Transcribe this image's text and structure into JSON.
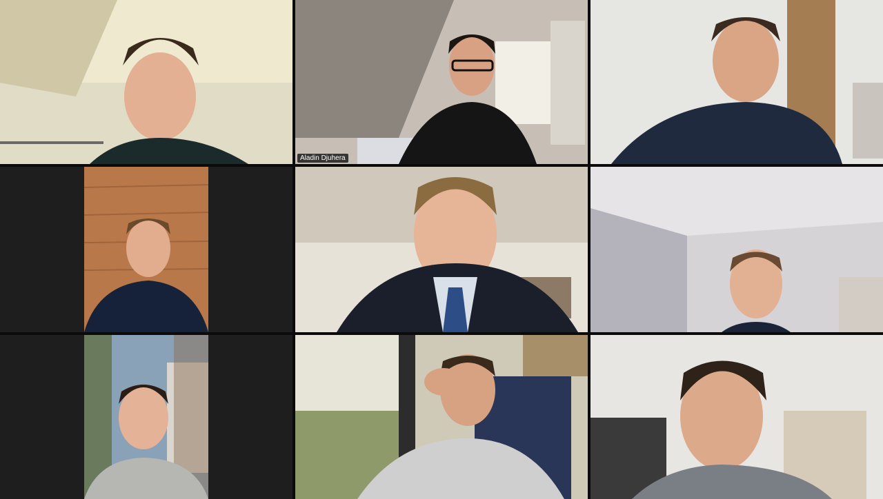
{
  "meeting": {
    "layout": "gallery-3x3",
    "active_speaker_index": 1
  },
  "participants": [
    {
      "id": "p1",
      "name": "",
      "colors": {
        "bg": "#d9d7c4",
        "shirt": "#1b2a2a",
        "hair": "#3a2a1c"
      }
    },
    {
      "id": "p2",
      "name": "Aladin Djuhera",
      "colors": {
        "bg": "#cfc8c0",
        "shirt": "#151515",
        "hair": "#1c1613"
      }
    },
    {
      "id": "p3",
      "name": "",
      "colors": {
        "bg": "#e6e6e3",
        "shirt": "#1f2a3f",
        "hair": "#3b2a1f"
      }
    },
    {
      "id": "p4",
      "name": "",
      "colors": {
        "bg": "#b8784a",
        "shirt": "#16223a",
        "hair": "#6b4a2c"
      }
    },
    {
      "id": "p5",
      "name": "",
      "colors": {
        "bg": "#dcd6cc",
        "shirt": "#1b1f2b",
        "hair": "#8b6b40"
      }
    },
    {
      "id": "p6",
      "name": "",
      "colors": {
        "bg": "#d5d3d6",
        "shirt": "#1a2338",
        "hair": "#6a4a30"
      }
    },
    {
      "id": "p7",
      "name": "",
      "colors": {
        "bg": "#8a9c8c",
        "shirt": "#b6b6b3",
        "hair": "#2a1d15"
      }
    },
    {
      "id": "p8",
      "name": "",
      "colors": {
        "bg": "#cfcab8",
        "shirt": "#cfcfcf",
        "hair": "#3a2a1c"
      }
    },
    {
      "id": "p9",
      "name": "",
      "colors": {
        "bg": "#e8e6e2",
        "shirt": "#7a7f85",
        "hair": "#2f2218"
      }
    }
  ]
}
